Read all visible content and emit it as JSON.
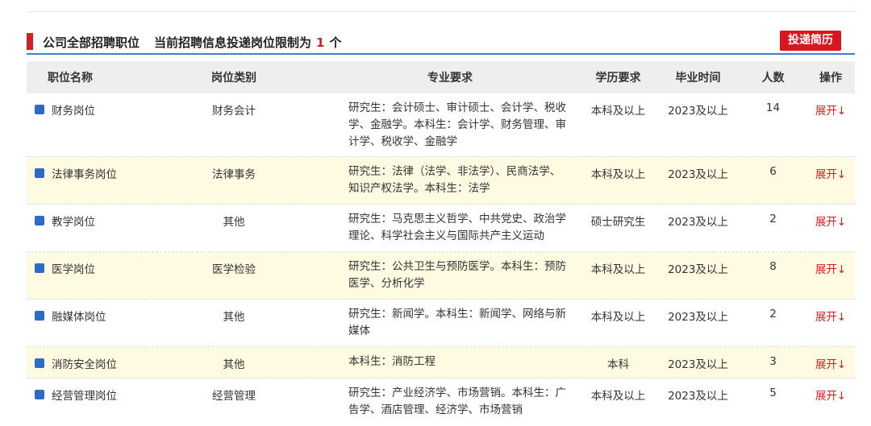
{
  "header": {
    "title": "公司全部招聘职位",
    "limit_prefix": "当前招聘信息投递岗位限制为",
    "limit_count": "1",
    "limit_suffix": "个",
    "apply_label": "投递简历"
  },
  "columns": [
    "职位名称",
    "岗位类别",
    "专业要求",
    "学历要求",
    "毕业时间",
    "人数",
    "操作"
  ],
  "rows": [
    {
      "name": "财务岗位",
      "category": "财务会计",
      "major": "研究生：会计硕士、审计硕士、会计学、税收学、金融学。本科生：会计学、财务管理、审计学、税收学、金融学",
      "education": "本科及以上",
      "graduation": "2023及以上",
      "count": "14",
      "action": "展开↓"
    },
    {
      "name": "法律事务岗位",
      "category": "法律事务",
      "major": "研究生：法律（法学、非法学）、民商法学、知识产权法学。本科生：法学",
      "education": "本科及以上",
      "graduation": "2023及以上",
      "count": "6",
      "action": "展开↓"
    },
    {
      "name": "教学岗位",
      "category": "其他",
      "major": "研究生：马克思主义哲学、中共党史、政治学理论、科学社会主义与国际共产主义运动",
      "education": "硕士研究生",
      "graduation": "2023及以上",
      "count": "2",
      "action": "展开↓"
    },
    {
      "name": "医学岗位",
      "category": "医学检验",
      "major": "研究生：公共卫生与预防医学。本科生：预防医学、分析化学",
      "education": "本科及以上",
      "graduation": "2023及以上",
      "count": "8",
      "action": "展开↓"
    },
    {
      "name": "融媒体岗位",
      "category": "其他",
      "major": "研究生：新闻学。本科生：新闻学、网络与新媒体",
      "education": "本科及以上",
      "graduation": "2023及以上",
      "count": "2",
      "action": "展开↓"
    },
    {
      "name": "消防安全岗位",
      "category": "其他",
      "major": "本科生：消防工程",
      "education": "本科",
      "graduation": "2023及以上",
      "count": "3",
      "action": "展开↓"
    },
    {
      "name": "经营管理岗位",
      "category": "经营管理",
      "major": "研究生：产业经济学、市场营销。本科生：广告学、酒店管理、经济学、市场营销",
      "education": "本科及以上",
      "graduation": "2023及以上",
      "count": "5",
      "action": "展开↓"
    }
  ],
  "colors": {
    "accent_red": "#d31f1f",
    "accent_blue": "#3d7fd3",
    "square_blue": "#2e6bc6",
    "alt_row": "#fffbe2",
    "header_bg": "#eeeeee"
  }
}
